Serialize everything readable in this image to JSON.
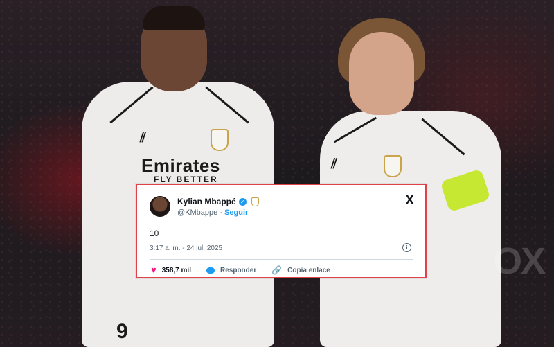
{
  "tweet": {
    "author_name": "Kylian Mbappé",
    "handle": "@KMbappe",
    "separator": "·",
    "follow_label": "Seguir",
    "text": "10",
    "timestamp": "3:17 a. m. - 24 jul. 2025",
    "likes": "358,7 mil",
    "reply_label": "Responder",
    "copy_link_label": "Copia enlace",
    "x_logo": "X"
  },
  "photo": {
    "sponsor_text": "Emirates",
    "sponsor_subtext": "FLY BETTER",
    "shirt_number": "9",
    "watermark": "OX"
  },
  "icons": {
    "verified": "verified-check-icon",
    "heart": "heart-icon",
    "reply": "speech-bubble-icon",
    "link": "link-icon",
    "info": "info-icon"
  },
  "colors": {
    "accent": "#1d9bf0",
    "like": "#f91880",
    "card_border": "#e0424a",
    "armband": "#c7e832"
  }
}
